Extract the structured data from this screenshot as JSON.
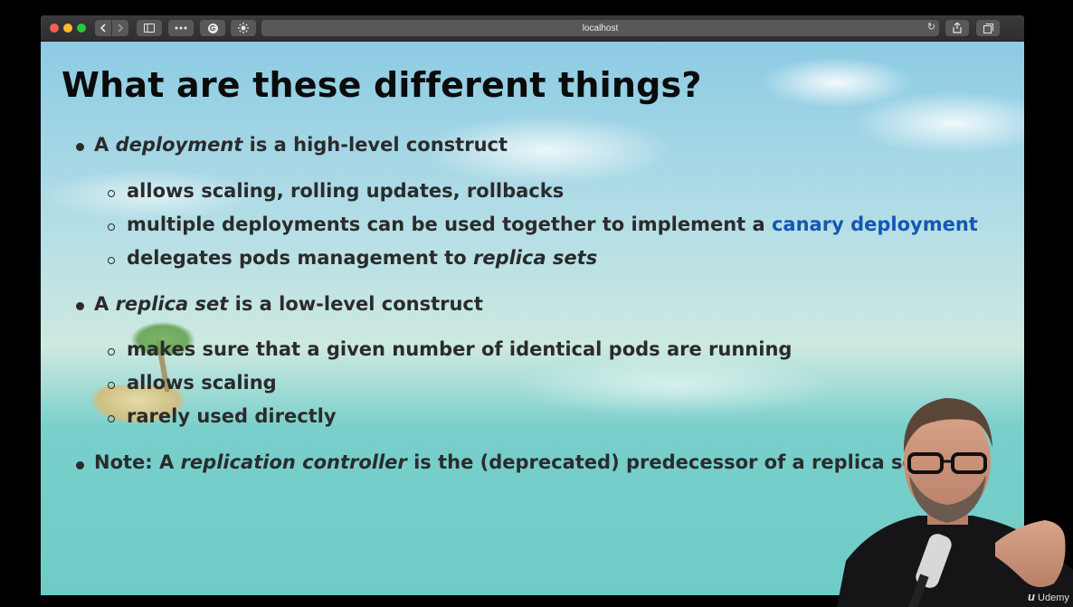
{
  "browser": {
    "url": "localhost",
    "icons": {
      "back": "chevron-left-icon",
      "forward": "chevron-right-icon",
      "sidebar": "sidebar-icon",
      "extensions": "more-dots-icon",
      "extension_g": "g-extension-icon",
      "brightness": "sun-icon",
      "reload": "reload-icon",
      "share": "share-icon",
      "tabs": "tabs-icon",
      "new_tab": "plus-icon"
    },
    "g_label": "G"
  },
  "slide": {
    "title": "What are these different things?",
    "bullet1": {
      "prefix": "A ",
      "emph": "deployment",
      "suffix": " is a high-level construct",
      "subs": [
        "allows scaling, rolling updates, rollbacks",
        "multiple deployments can be used together to implement a ",
        "delegates pods management to "
      ],
      "sub2_link": "canary deployment",
      "sub3_emph": "replica sets"
    },
    "bullet2": {
      "prefix": "A ",
      "emph": "replica set",
      "suffix": " is a low-level construct",
      "subs": [
        "makes sure that a given number of identical pods are running",
        "allows scaling",
        "rarely used directly"
      ]
    },
    "bullet3": {
      "prefix": "Note: A ",
      "emph": "replication controller",
      "suffix": " is the (deprecated) predecessor of a replica set"
    }
  },
  "watermark": {
    "logo": "u",
    "text": "Udemy"
  },
  "colors": {
    "link": "#1558b0",
    "text": "#2b2b2b",
    "title": "#0b0b0b"
  }
}
